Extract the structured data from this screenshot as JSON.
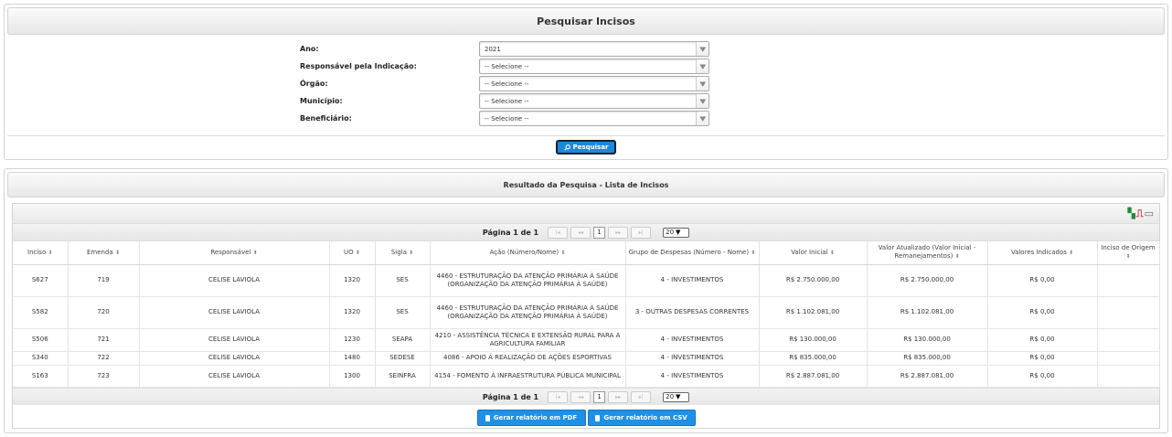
{
  "search": {
    "title": "Pesquisar Incisos",
    "fields": [
      {
        "label": "Ano:",
        "value": "2021"
      },
      {
        "label": "Responsável pela Indicação:",
        "value": "-- Selecione --"
      },
      {
        "label": "Órgão:",
        "value": "-- Selecione --"
      },
      {
        "label": "Município:",
        "value": "-- Selecione --"
      },
      {
        "label": "Beneficiário:",
        "value": "-- Selecione --"
      }
    ],
    "button_label": "Pesquisar"
  },
  "results": {
    "title": "Resultado da Pesquisa - Lista de Incisos",
    "pager": {
      "text": "Página 1 de 1",
      "current_page": "1",
      "page_size": "20",
      "first": "|◂",
      "prev": "◂◂",
      "next": "▸▸",
      "last": "▸|"
    },
    "columns": [
      "Inciso",
      "Emenda",
      "Responsável",
      "UO",
      "Sigla",
      "Ação (Número/Nome)",
      "Grupo de Despesas (Número - Nome)",
      "Valor Inicial",
      "Valor Atualizado (Valor Inicial - Remanejamentos)",
      "Valores Indicados",
      "Inciso de Origem"
    ],
    "rows": [
      [
        "S627",
        "719",
        "CELISE LAVIOLA",
        "1320",
        "SES",
        "4460 - ESTRUTURAÇÃO DA ATENÇÃO PRIMÁRIA À SAÚDE (ORGANIZAÇÃO DA ATENÇÃO PRIMÁRIA À SAÚDE)",
        "4 - INVESTIMENTOS",
        "R$ 2.750.000,00",
        "R$ 2.750.000,00",
        "R$ 0,00",
        ""
      ],
      [
        "S582",
        "720",
        "CELISE LAVIOLA",
        "1320",
        "SES",
        "4460 - ESTRUTURAÇÃO DA ATENÇÃO PRIMÁRIA À SAÚDE (ORGANIZAÇÃO DA ATENÇÃO PRIMÁRIA À SAÚDE)",
        "3 - OUTRAS DESPESAS CORRENTES",
        "R$ 1.102.081,00",
        "R$ 1.102.081,00",
        "R$ 0,00",
        ""
      ],
      [
        "S506",
        "721",
        "CELISE LAVIOLA",
        "1230",
        "SEAPA",
        "4210 - ASSISTÊNCIA TÉCNICA E EXTENSÃO RURAL PARA A AGRICULTURA FAMILIAR",
        "4 - INVESTIMENTOS",
        "R$ 130.000,00",
        "R$ 130.000,00",
        "R$ 0,00",
        ""
      ],
      [
        "S340",
        "722",
        "CELISE LAVIOLA",
        "1480",
        "SEDESE",
        "4086 - APOIO À REALIZAÇÃO DE AÇÕES ESPORTIVAS",
        "4 - INVESTIMENTOS",
        "R$ 835.000,00",
        "R$ 835.000,00",
        "R$ 0,00",
        ""
      ],
      [
        "S163",
        "723",
        "CELISE LAVIOLA",
        "1300",
        "SEINFRA",
        "4154 - FOMENTO À INFRAESTRUTURA PÚBLICA MUNICIPAL",
        "4 - INVESTIMENTOS",
        "R$ 2.887.081,00",
        "R$ 2.887.081,00",
        "R$ 0,00",
        ""
      ]
    ],
    "pdf_button": "Gerar relatório em PDF",
    "csv_button": "Gerar relatório em CSV"
  },
  "icons": {
    "sort": "sort-icon",
    "search_button": "magnifier-icon",
    "export": [
      "excel-icon",
      "pdf-icon",
      "print-icon"
    ]
  }
}
